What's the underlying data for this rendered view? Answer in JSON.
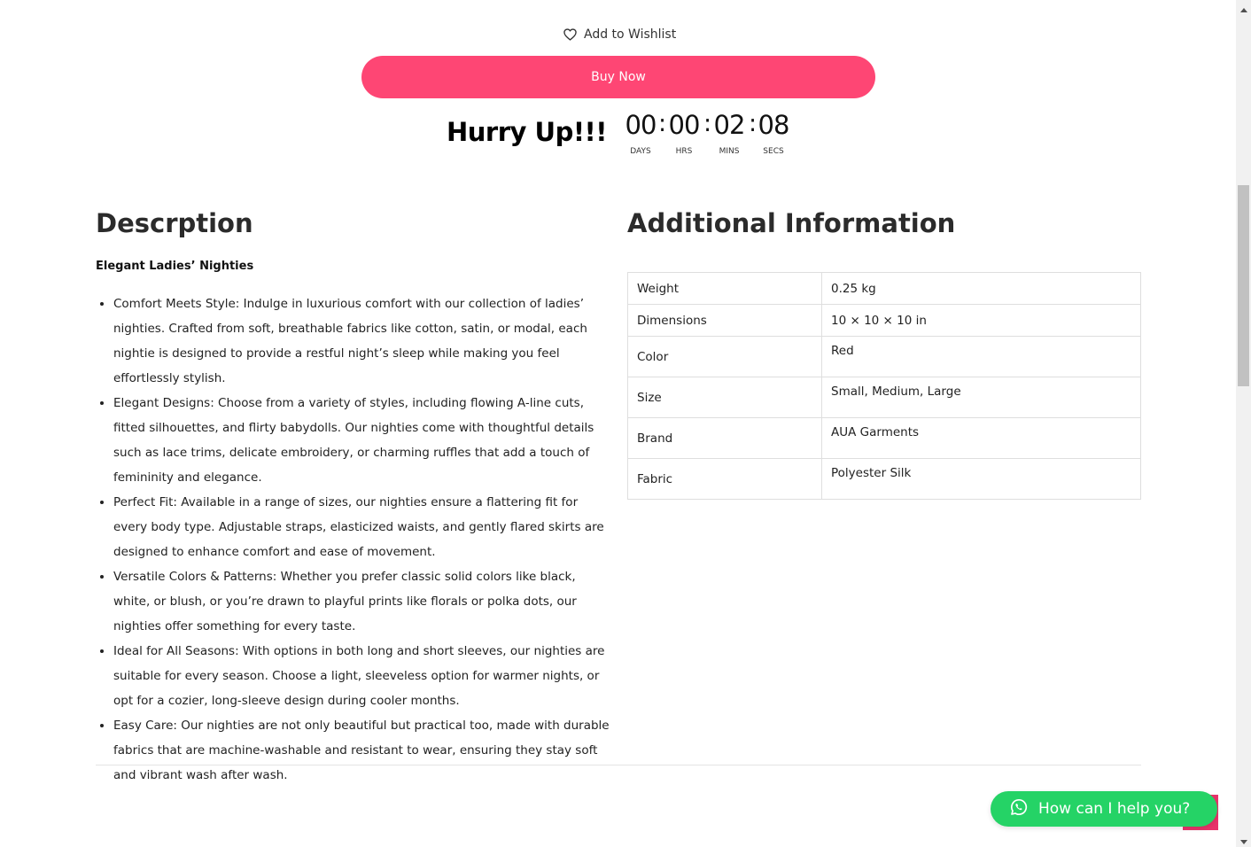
{
  "wishlist": {
    "label": "Add to Wishlist",
    "icon": "heart-icon"
  },
  "buy_now": {
    "label": "Buy Now",
    "color": "#fe4674"
  },
  "countdown": {
    "heading": "Hurry Up!!!",
    "units": [
      {
        "value": "00",
        "label": "DAYS"
      },
      {
        "value": "00",
        "label": "HRS"
      },
      {
        "value": "02",
        "label": "MINS"
      },
      {
        "value": "08",
        "label": "SECS"
      }
    ],
    "separator": ":"
  },
  "description": {
    "title": "Descrption",
    "subtitle": "Elegant Ladies’ Nighties",
    "items": [
      "Comfort Meets Style: Indulge in luxurious comfort with our collection of ladies’ nighties. Crafted from soft, breathable fabrics like cotton, satin, or modal, each nightie is designed to provide a restful night’s sleep while making you feel effortlessly stylish.",
      "Elegant Designs: Choose from a variety of styles, including flowing A-line cuts, fitted silhouettes, and flirty babydolls. Our nighties come with thoughtful details such as lace trims, delicate embroidery, or charming ruffles that add a touch of femininity and elegance.",
      "Perfect Fit: Available in a range of sizes, our nighties ensure a flattering fit for every body type. Adjustable straps, elasticized waists, and gently flared skirts are designed to enhance comfort and ease of movement.",
      "Versatile Colors & Patterns: Whether you prefer classic solid colors like black, white, or blush, or you’re drawn to playful prints like florals or polka dots, our nighties offer something for every taste.",
      "Ideal for All Seasons: With options in both long and short sleeves, our nighties are suitable for every season. Choose a light, sleeveless option for warmer nights, or opt for a cozier, long-sleeve design during cooler months.",
      "Easy Care: Our nighties are not only beautiful but practical too, made with durable fabrics that are machine-washable and resistant to wear, ensuring they stay soft and vibrant wash after wash."
    ]
  },
  "additional_info": {
    "title": "Additional Information",
    "rows": [
      {
        "key": "Weight",
        "value": "0.25 kg"
      },
      {
        "key": "Dimensions",
        "value": "10 × 10 × 10 in"
      },
      {
        "key": "Color",
        "value": "Red"
      },
      {
        "key": "Size",
        "value": "Small, Medium, Large"
      },
      {
        "key": "Brand",
        "value": "AUA Garments"
      },
      {
        "key": "Fabric",
        "value": "Polyester Silk"
      }
    ]
  },
  "whatsapp": {
    "label": "How can I help you?",
    "icon": "whatsapp-icon",
    "color": "#25d366"
  },
  "back_to_top": {
    "icon": "back-to-top-icon",
    "color": "#e8336b"
  }
}
